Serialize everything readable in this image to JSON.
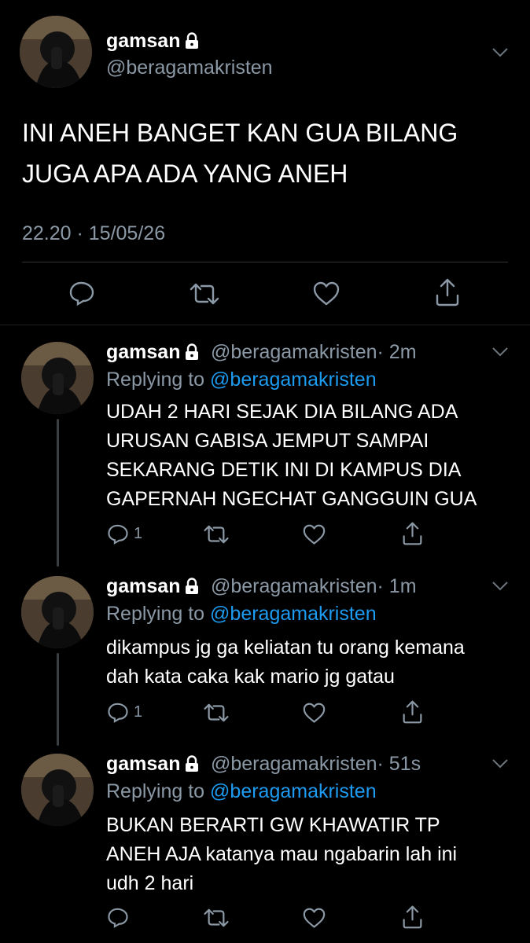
{
  "main_tweet": {
    "display_name": "gamsan",
    "handle": "@beragamakristen",
    "text_lines": [
      "INI ANEH BANGET KAN GUA BILANG",
      "JUGA APA ADA YANG ANEH"
    ],
    "timestamp": "22.20 · 15/05/26"
  },
  "replies": [
    {
      "display_name": "gamsan",
      "handle": "@beragamakristen",
      "time": "· 2m",
      "replying_prefix": "Replying to",
      "replying_to": "@beragamakristen",
      "text_lines": [
        "UDAH 2 HARI SEJAK DIA BILANG ADA",
        "URUSAN GABISA JEMPUT SAMPAI",
        "SEKARANG DETIK INI DI KAMPUS DIA",
        "GAPERNAH NGECHAT GANGGUIN GUA"
      ],
      "reply_count": "1"
    },
    {
      "display_name": "gamsan",
      "handle": "@beragamakristen",
      "time": "· 1m",
      "replying_prefix": "Replying to",
      "replying_to": "@beragamakristen",
      "text_lines": [
        "dikampus jg ga keliatan tu orang kemana",
        "dah kata caka kak mario jg gatau"
      ],
      "reply_count": "1"
    },
    {
      "display_name": "gamsan",
      "handle": "@beragamakristen",
      "time": "· 51s",
      "replying_prefix": "Replying to",
      "replying_to": "@beragamakristen",
      "text_lines": [
        "BUKAN BERARTI GW KHAWATIR TP",
        "ANEH AJA katanya mau ngabarin lah ini",
        "udh 2 hari"
      ],
      "reply_count": ""
    }
  ],
  "icons": {
    "lock": "lock-icon",
    "chevron": "chevron-down-icon",
    "reply": "reply-icon",
    "retweet": "retweet-icon",
    "like": "heart-icon",
    "share": "share-icon"
  },
  "colors": {
    "background": "#000000",
    "muted": "#8b98a5",
    "link": "#1d9bf0",
    "separator": "#2f3336"
  }
}
